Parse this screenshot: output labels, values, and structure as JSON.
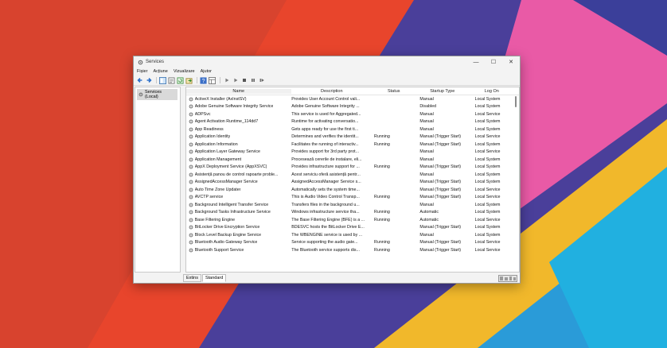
{
  "window": {
    "title": "Services",
    "controls": [
      "—",
      "☐",
      "✕"
    ]
  },
  "menu": [
    "Fișier",
    "Acțiune",
    "Vizualizare",
    "Ajutor"
  ],
  "toolbar_icons": [
    "back-icon",
    "forward-icon",
    "console-tree-icon",
    "properties-icon",
    "refresh-icon",
    "export-icon",
    "help-icon",
    "show-hide-icon",
    "start-icon",
    "start-alt-icon",
    "stop-icon",
    "pause-icon",
    "restart-icon"
  ],
  "tree": {
    "root_label": "Services (Local)"
  },
  "columns": {
    "name": "Name",
    "description": "Description",
    "status": "Status",
    "startup": "Startup Type",
    "logon": "Log On"
  },
  "rows": [
    {
      "name": "ActiveX Installer (AxInstSV)",
      "description": "Provides User Account Control vali...",
      "status": "",
      "startup": "Manual",
      "logon": "Local System"
    },
    {
      "name": "Adobe Genuine Software Integrity Service",
      "description": "Adobe Genuine Software Integrity ...",
      "status": "",
      "startup": "Disabled",
      "logon": "Local System"
    },
    {
      "name": "ADPSvc",
      "description": "This service is used for Aggregated...",
      "status": "",
      "startup": "Manual",
      "logon": "Local Service"
    },
    {
      "name": "Agent Activation Runtime_114dd7",
      "description": "Runtime for activating conversatio...",
      "status": "",
      "startup": "Manual",
      "logon": "Local System"
    },
    {
      "name": "App Readiness",
      "description": "Gets apps ready for use the first ti...",
      "status": "",
      "startup": "Manual",
      "logon": "Local System"
    },
    {
      "name": "Application Identity",
      "description": "Determines and verifies the identit...",
      "status": "Running",
      "startup": "Manual (Trigger Start)",
      "logon": "Local Service"
    },
    {
      "name": "Application Information",
      "description": "Facilitates the running of interactiv...",
      "status": "Running",
      "startup": "Manual (Trigger Start)",
      "logon": "Local System"
    },
    {
      "name": "Application Layer Gateway Service",
      "description": "Provides support for 3rd party prot...",
      "status": "",
      "startup": "Manual",
      "logon": "Local Service"
    },
    {
      "name": "Application Management",
      "description": "Procesează cererile de instalare, eli...",
      "status": "",
      "startup": "Manual",
      "logon": "Local System"
    },
    {
      "name": "AppX Deployment Service (AppXSVC)",
      "description": "Provides infrastructure support for ...",
      "status": "Running",
      "startup": "Manual (Trigger Start)",
      "logon": "Local System"
    },
    {
      "name": "Asistență panou de control rapoarte proble...",
      "description": "Acest serviciu oferă asistență pentr...",
      "status": "",
      "startup": "Manual",
      "logon": "Local System"
    },
    {
      "name": "AssignedAccessManager Service",
      "description": "AssignedAccessManager Service s...",
      "status": "",
      "startup": "Manual (Trigger Start)",
      "logon": "Local System"
    },
    {
      "name": "Auto Time Zone Updater",
      "description": "Automatically sets the system time...",
      "status": "",
      "startup": "Manual (Trigger Start)",
      "logon": "Local Service"
    },
    {
      "name": "AVCTP service",
      "description": "This is Audio Video Control Transp...",
      "status": "Running",
      "startup": "Manual (Trigger Start)",
      "logon": "Local Service"
    },
    {
      "name": "Background Intelligent Transfer Service",
      "description": "Transfers files in the background u...",
      "status": "",
      "startup": "Manual",
      "logon": "Local System"
    },
    {
      "name": "Background Tasks Infrastructure Service",
      "description": "Windows infrastructure service tha...",
      "status": "Running",
      "startup": "Automatic",
      "logon": "Local System"
    },
    {
      "name": "Base Filtering Engine",
      "description": "The Base Filtering Engine (BFE) is a ...",
      "status": "Running",
      "startup": "Automatic",
      "logon": "Local Service"
    },
    {
      "name": "BitLocker Drive Encryption Service",
      "description": "BDESVC hosts the BitLocker Drive E...",
      "status": "",
      "startup": "Manual (Trigger Start)",
      "logon": "Local System"
    },
    {
      "name": "Block Level Backup Engine Service",
      "description": "The WBENGINE service is used by ...",
      "status": "",
      "startup": "Manual",
      "logon": "Local System"
    },
    {
      "name": "Bluetooth Audio Gateway Service",
      "description": "Service supporting the audio gate...",
      "status": "Running",
      "startup": "Manual (Trigger Start)",
      "logon": "Local Service"
    },
    {
      "name": "Bluetooth Support Service",
      "description": "The Bluetooth service supports dis...",
      "status": "Running",
      "startup": "Manual (Trigger Start)",
      "logon": "Local Service"
    }
  ],
  "tabs": [
    "Extins",
    "Standard"
  ],
  "colors": {
    "accent": "#0078d4",
    "window_bg": "#f3f3f3",
    "list_bg": "#ffffff"
  }
}
